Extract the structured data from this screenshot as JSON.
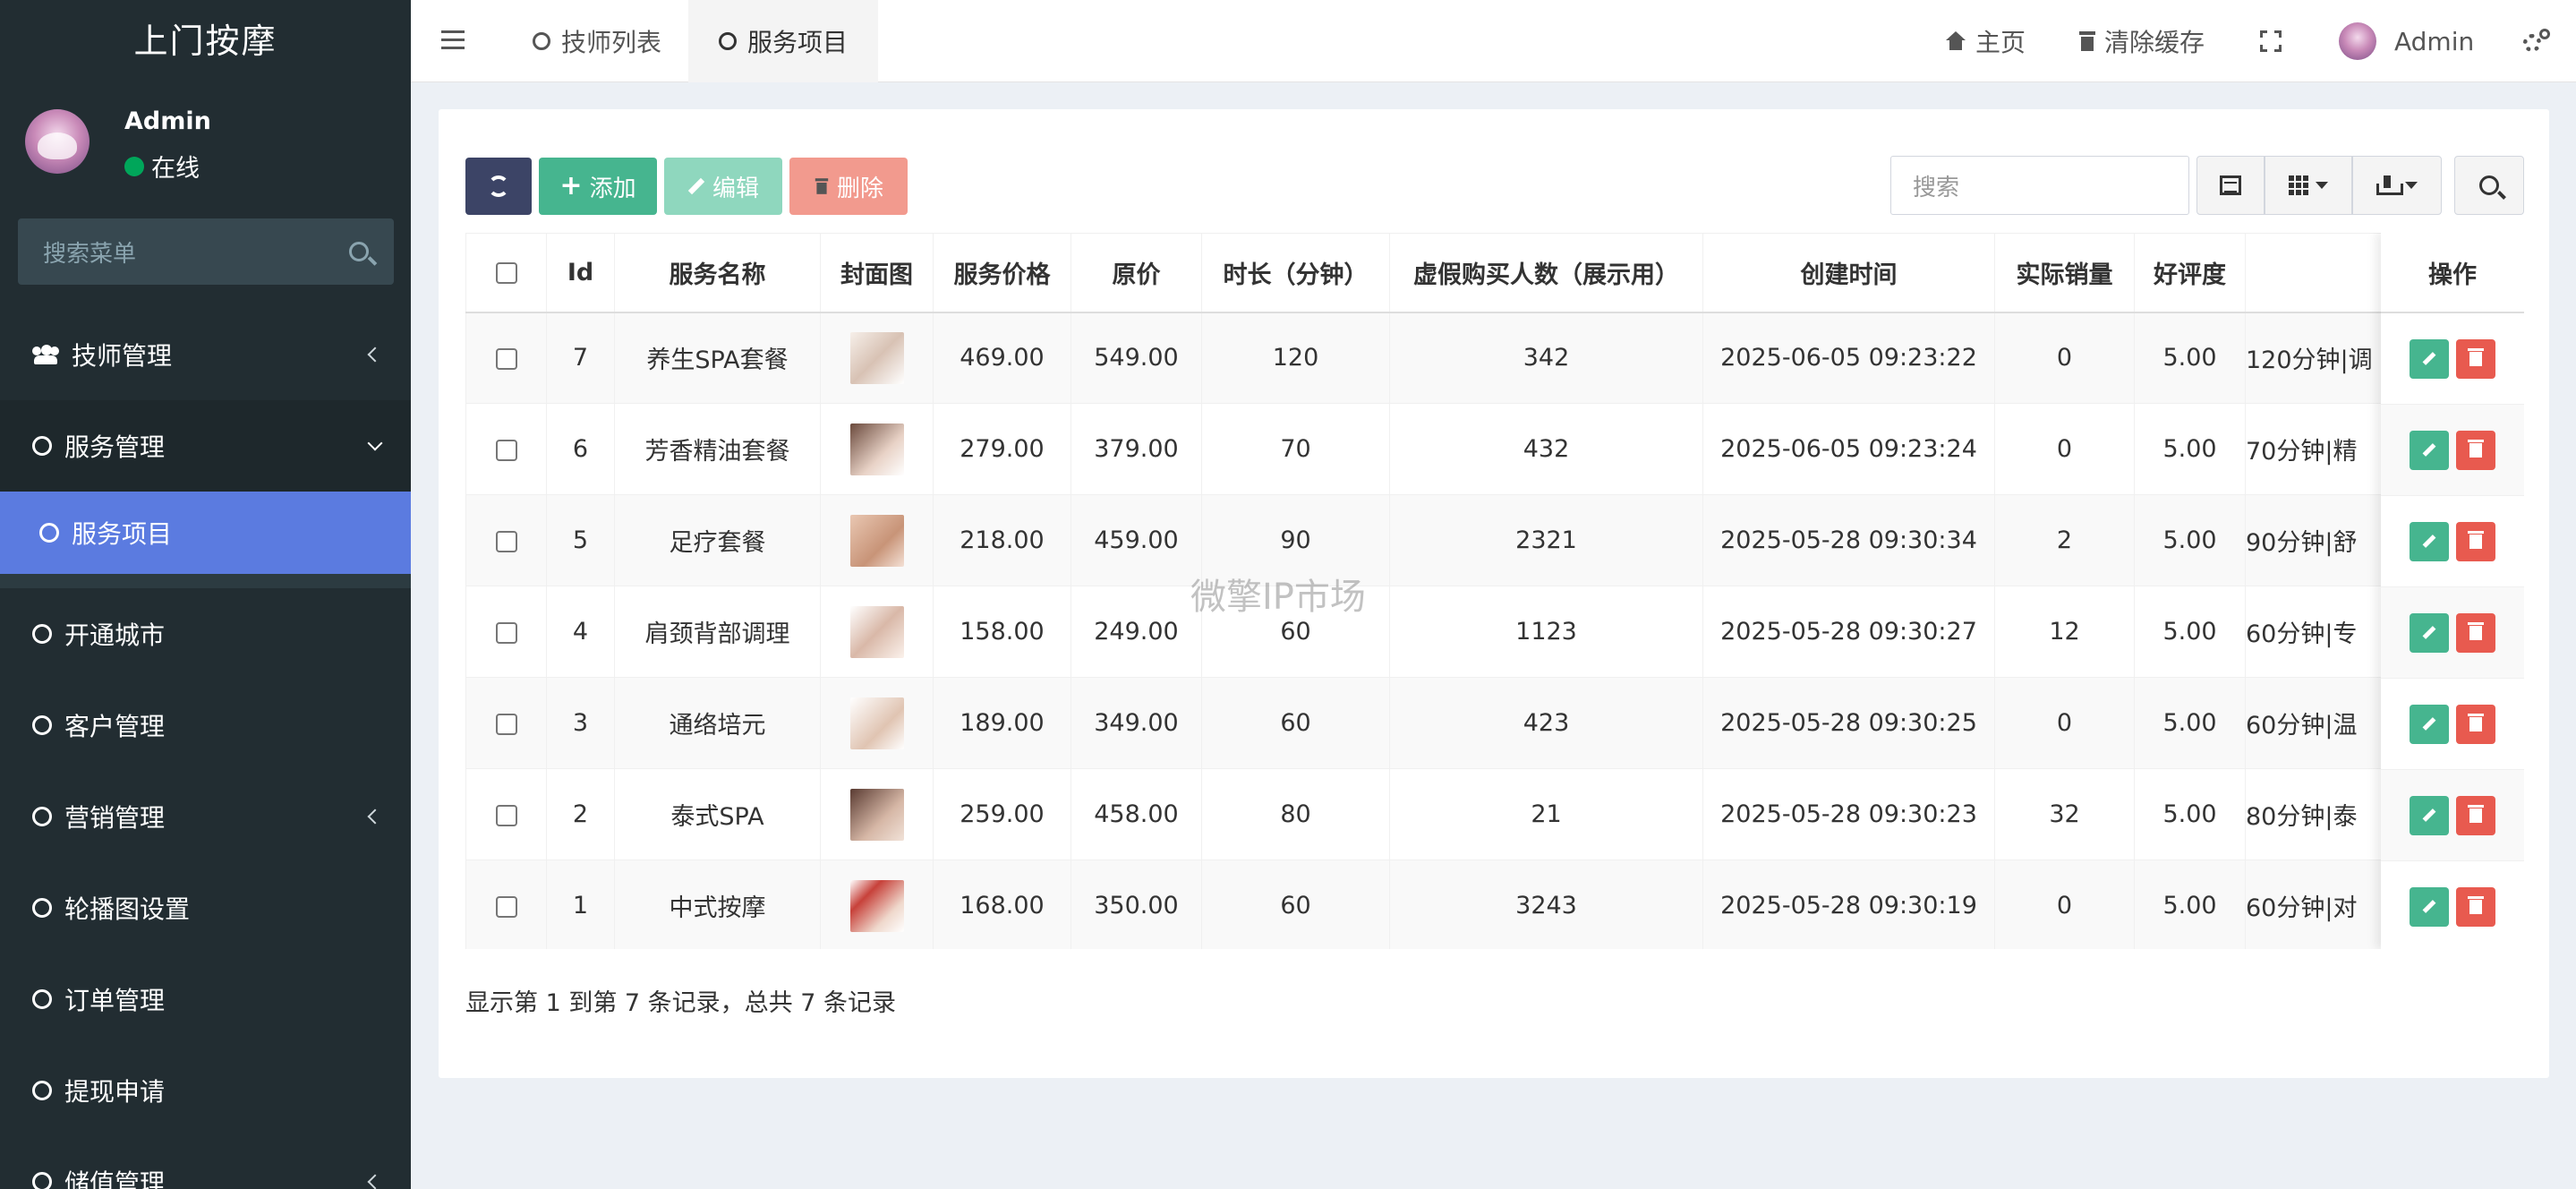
{
  "app": {
    "title": "上门按摩"
  },
  "user": {
    "name": "Admin",
    "status": "在线"
  },
  "sidebar": {
    "search_placeholder": "搜索菜单",
    "items": [
      {
        "label": "技师管理"
      },
      {
        "label": "服务管理"
      },
      {
        "label": "服务项目"
      },
      {
        "label": "开通城市"
      },
      {
        "label": "客户管理"
      },
      {
        "label": "营销管理"
      },
      {
        "label": "轮播图设置"
      },
      {
        "label": "订单管理"
      },
      {
        "label": "提现申请"
      },
      {
        "label": "储值管理"
      }
    ]
  },
  "header": {
    "tabs": [
      {
        "label": "技师列表"
      },
      {
        "label": "服务项目"
      }
    ],
    "home": "主页",
    "clear_cache": "清除缓存",
    "admin": "Admin"
  },
  "toolbar": {
    "add": "添加",
    "edit": "编辑",
    "delete": "删除",
    "search_placeholder": "搜索"
  },
  "table": {
    "columns": [
      "Id",
      "服务名称",
      "封面图",
      "服务价格",
      "原价",
      "时长（分钟）",
      "虚假购买人数（展示用）",
      "创建时间",
      "实际销量",
      "好评度",
      "操作"
    ],
    "rows": [
      {
        "id": "7",
        "name": "养生SPA套餐",
        "price": "469.00",
        "orig": "549.00",
        "dur": "120",
        "fake": "342",
        "time": "2025-06-05 09:23:22",
        "sales": "0",
        "rating": "5.00",
        "desc": "120分钟|调"
      },
      {
        "id": "6",
        "name": "芳香精油套餐",
        "price": "279.00",
        "orig": "379.00",
        "dur": "70",
        "fake": "432",
        "time": "2025-06-05 09:23:24",
        "sales": "0",
        "rating": "5.00",
        "desc": "70分钟|精"
      },
      {
        "id": "5",
        "name": "足疗套餐",
        "price": "218.00",
        "orig": "459.00",
        "dur": "90",
        "fake": "2321",
        "time": "2025-05-28 09:30:34",
        "sales": "2",
        "rating": "5.00",
        "desc": "90分钟|舒"
      },
      {
        "id": "4",
        "name": "肩颈背部调理",
        "price": "158.00",
        "orig": "249.00",
        "dur": "60",
        "fake": "1123",
        "time": "2025-05-28 09:30:27",
        "sales": "12",
        "rating": "5.00",
        "desc": "60分钟|专"
      },
      {
        "id": "3",
        "name": "通络培元",
        "price": "189.00",
        "orig": "349.00",
        "dur": "60",
        "fake": "423",
        "time": "2025-05-28 09:30:25",
        "sales": "0",
        "rating": "5.00",
        "desc": "60分钟|温"
      },
      {
        "id": "2",
        "name": "泰式SPA",
        "price": "259.00",
        "orig": "458.00",
        "dur": "80",
        "fake": "21",
        "time": "2025-05-28 09:30:23",
        "sales": "32",
        "rating": "5.00",
        "desc": "80分钟|泰"
      },
      {
        "id": "1",
        "name": "中式按摩",
        "price": "168.00",
        "orig": "350.00",
        "dur": "60",
        "fake": "3243",
        "time": "2025-05-28 09:30:19",
        "sales": "0",
        "rating": "5.00",
        "desc": "60分钟|对"
      }
    ]
  },
  "pagination": {
    "summary": "显示第 1 到第 7 条记录，总共 7 条记录"
  },
  "watermark": "微擎IP市场",
  "colors": {
    "sidebar_bg": "#222d32",
    "active_item": "#5b7be0",
    "primary_green": "#46b58f",
    "danger_red": "#e85a4f",
    "refresh_btn": "#3c4466"
  }
}
